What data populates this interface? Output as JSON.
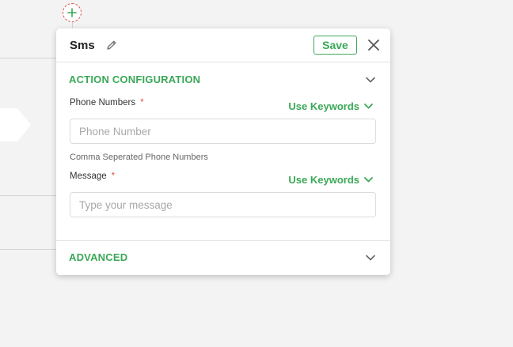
{
  "canvas": {
    "add_node_icon": "plus-icon"
  },
  "panel": {
    "title": "Sms",
    "edit_icon": "pencil-icon",
    "save_label": "Save",
    "close_icon": "close-icon"
  },
  "action_configuration": {
    "title": "ACTION CONFIGURATION",
    "fields": [
      {
        "label": "Phone Numbers",
        "required_mark": "*",
        "use_keywords_label": "Use Keywords",
        "placeholder": "Phone Number",
        "value": "",
        "help_text": "Comma Seperated Phone Numbers"
      },
      {
        "label": "Message",
        "required_mark": "*",
        "use_keywords_label": "Use Keywords",
        "placeholder": "Type your message",
        "value": ""
      }
    ]
  },
  "advanced": {
    "title": "ADVANCED"
  },
  "colors": {
    "accent": "#3aa857",
    "required": "#d9534f",
    "background": "#f3f3f3"
  }
}
